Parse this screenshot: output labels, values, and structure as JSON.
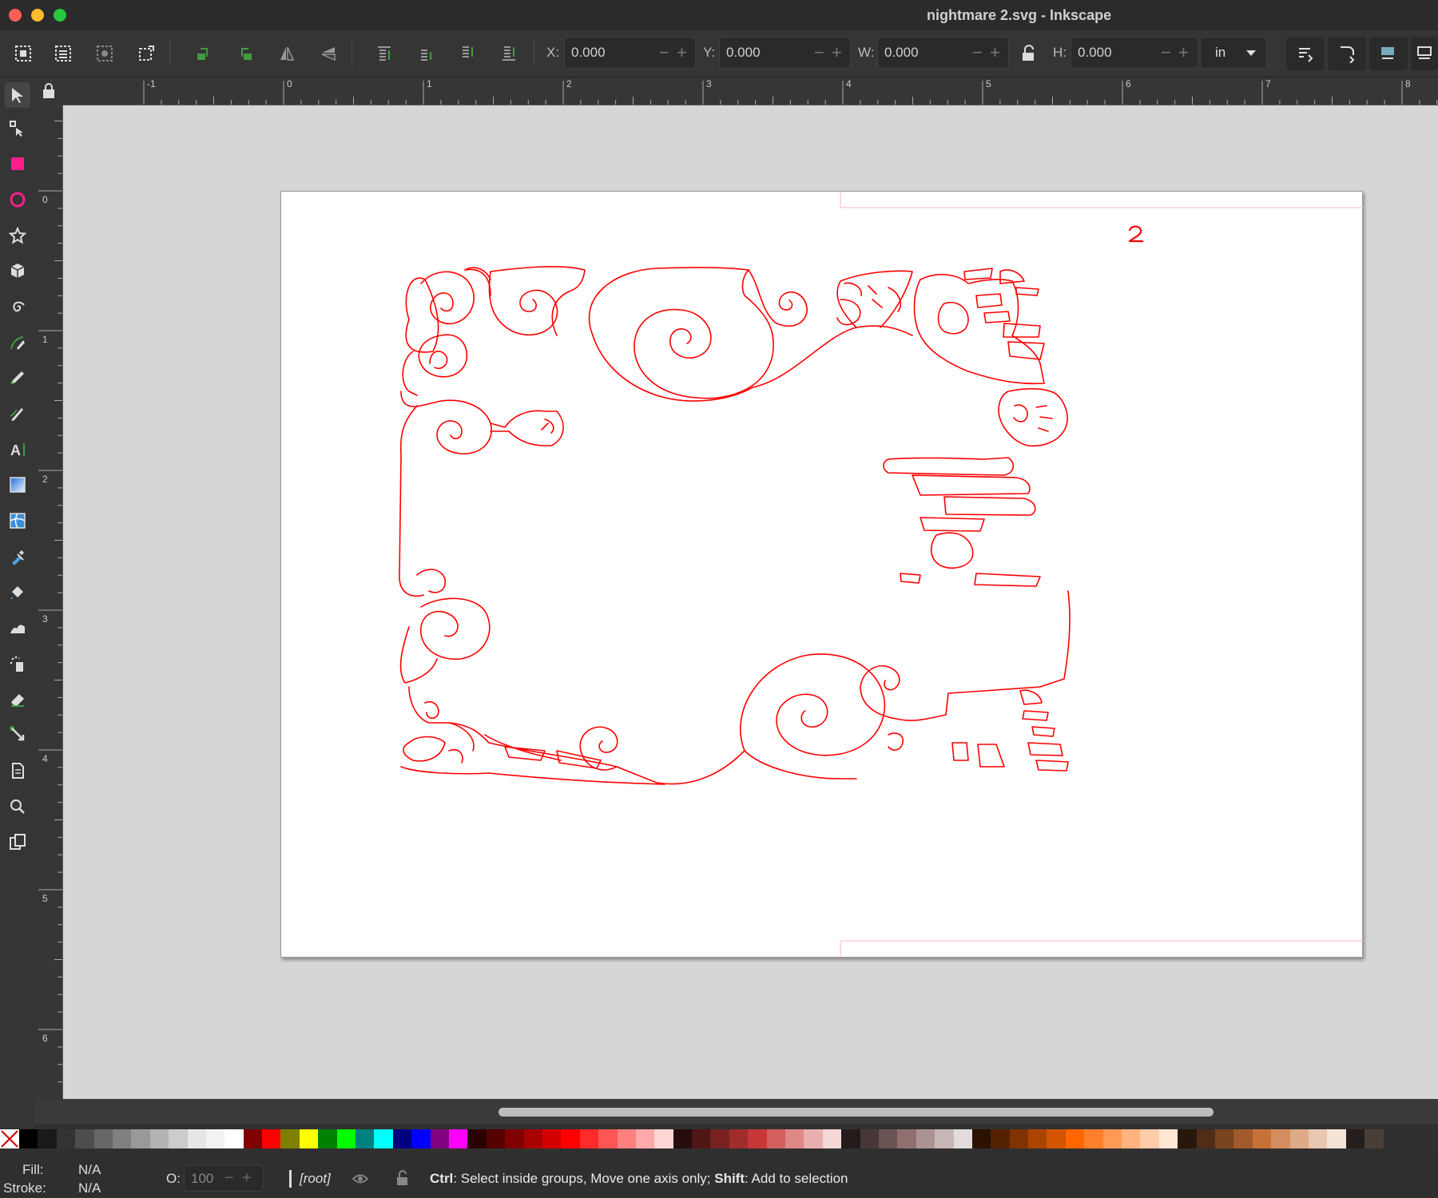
{
  "window": {
    "title": "nightmare 2.svg - Inkscape"
  },
  "toolbar": {
    "x_label": "X:",
    "x_value": "0.000",
    "y_label": "Y:",
    "y_value": "0.000",
    "w_label": "W:",
    "w_value": "0.000",
    "h_label": "H:",
    "h_value": "0.000",
    "unit": "in"
  },
  "tools": [
    {
      "name": "selector-tool-icon"
    },
    {
      "name": "node-tool-icon"
    },
    {
      "name": "rectangle-tool-icon"
    },
    {
      "name": "ellipse-tool-icon"
    },
    {
      "name": "star-tool-icon"
    },
    {
      "name": "box3d-tool-icon"
    },
    {
      "name": "spiral-tool-icon"
    },
    {
      "name": "bezier-pen-tool-icon"
    },
    {
      "name": "pencil-tool-icon"
    },
    {
      "name": "calligraphy-tool-icon"
    },
    {
      "name": "text-tool-icon"
    },
    {
      "name": "gradient-tool-icon"
    },
    {
      "name": "mesh-tool-icon"
    },
    {
      "name": "dropper-tool-icon"
    },
    {
      "name": "paint-bucket-tool-icon"
    },
    {
      "name": "tweak-tool-icon"
    },
    {
      "name": "spray-tool-icon"
    },
    {
      "name": "eraser-tool-icon"
    },
    {
      "name": "connector-tool-icon"
    },
    {
      "name": "pages-tool-icon"
    },
    {
      "name": "zoom-tool-icon"
    },
    {
      "name": "clone-tool-icon"
    }
  ],
  "hruler": {
    "labels": [
      "-1",
      "0",
      "1",
      "2",
      "3",
      "4",
      "5",
      "6",
      "7",
      "8"
    ]
  },
  "vruler": {
    "labels": [
      "0",
      "1",
      "2",
      "3",
      "4",
      "5",
      "6"
    ]
  },
  "page": {
    "page_number": "2",
    "stroke_color": "#ff0000"
  },
  "palette": [
    "#000000",
    "#1a1a1a",
    "#333333",
    "#4d4d4d",
    "#666666",
    "#808080",
    "#999999",
    "#b3b3b3",
    "#cccccc",
    "#e6e6e6",
    "#f2f2f2",
    "#ffffff",
    "#800000",
    "#ff0000",
    "#808000",
    "#ffff00",
    "#008000",
    "#00ff00",
    "#008080",
    "#00ffff",
    "#000080",
    "#0000ff",
    "#800080",
    "#ff00ff",
    "#2b0000",
    "#550000",
    "#800000",
    "#aa0000",
    "#d40000",
    "#ff0000",
    "#ff2a2a",
    "#ff5555",
    "#ff8080",
    "#ffaaaa",
    "#ffd5d5",
    "#280b0b",
    "#501616",
    "#782121",
    "#a02c2c",
    "#c83737",
    "#d35f5f",
    "#de8787",
    "#e9afaf",
    "#f4d7d7",
    "#241c1c",
    "#483737",
    "#6c5353",
    "#916f6f",
    "#ac9393",
    "#c8b7b7",
    "#e3dbdb",
    "#2b1100",
    "#552200",
    "#803300",
    "#aa4400",
    "#d45500",
    "#ff6600",
    "#ff7f2a",
    "#ff9955",
    "#ffb380",
    "#ffccaa",
    "#ffe6d5",
    "#28170b",
    "#502d16",
    "#784421",
    "#a05a2c",
    "#c87137",
    "#d38d5f",
    "#deaa87",
    "#e9c6af",
    "#f4e3d7",
    "#241f1c",
    "#483e37"
  ],
  "status": {
    "fill_label": "Fill:",
    "fill_value": "N/A",
    "stroke_label": "Stroke:",
    "stroke_value": "N/A",
    "opacity_label": "O:",
    "opacity_value": "100",
    "layer": "[root]",
    "msg_ctrl": "Ctrl",
    "msg_ctrl_text": ": Select inside groups, Move one axis only; ",
    "msg_shift": "Shift",
    "msg_shift_text": ": Add to selection"
  }
}
